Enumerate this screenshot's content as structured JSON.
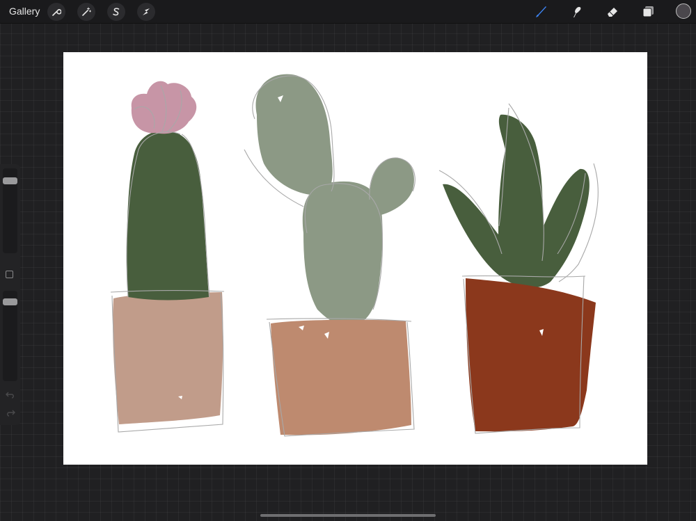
{
  "toolbar": {
    "gallery_label": "Gallery",
    "left_tools": [
      "wrench-icon",
      "magic-wand-icon",
      "selection-s-icon",
      "transform-arrow-icon"
    ],
    "right_tools": [
      "brush-icon",
      "smudge-icon",
      "eraser-icon",
      "layers-icon"
    ],
    "active_tool": "brush-icon",
    "active_color": "#3c82f0",
    "current_color": "#4a474c"
  },
  "sidebar": {
    "brush_size_level": 0.93,
    "opacity_level": 0.96
  },
  "colors": {
    "flower_pink": "#c795a6",
    "dark_green": "#485e3d",
    "sage_green": "#8c9985",
    "pot_beige": "#c19c8a",
    "pot_terracotta": "#be8a6f",
    "pot_rust": "#8b381c",
    "sketch_gray": "#a8a8a8"
  }
}
